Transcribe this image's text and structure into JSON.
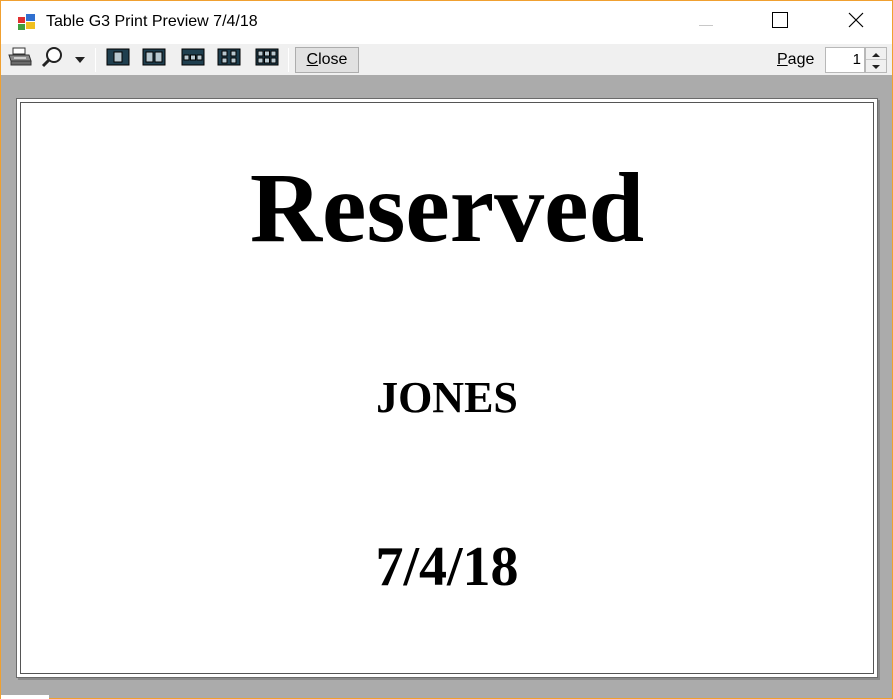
{
  "window": {
    "title": "Table G3 Print Preview 7/4/18"
  },
  "toolbar": {
    "close_label_underlined": "C",
    "close_label_rest": "lose",
    "page_label_underlined": "P",
    "page_label_rest": "age",
    "page_value": "1"
  },
  "document": {
    "heading": "Reserved",
    "name": "JONES",
    "date": "7/4/18"
  },
  "icons": [
    "app-icon",
    "print-icon",
    "zoom-icon",
    "dropdown-arrow-icon",
    "one-page-icon",
    "two-pages-icon",
    "three-pages-icon",
    "four-pages-icon",
    "six-pages-icon",
    "minimize-icon",
    "maximize-icon",
    "close-icon"
  ]
}
